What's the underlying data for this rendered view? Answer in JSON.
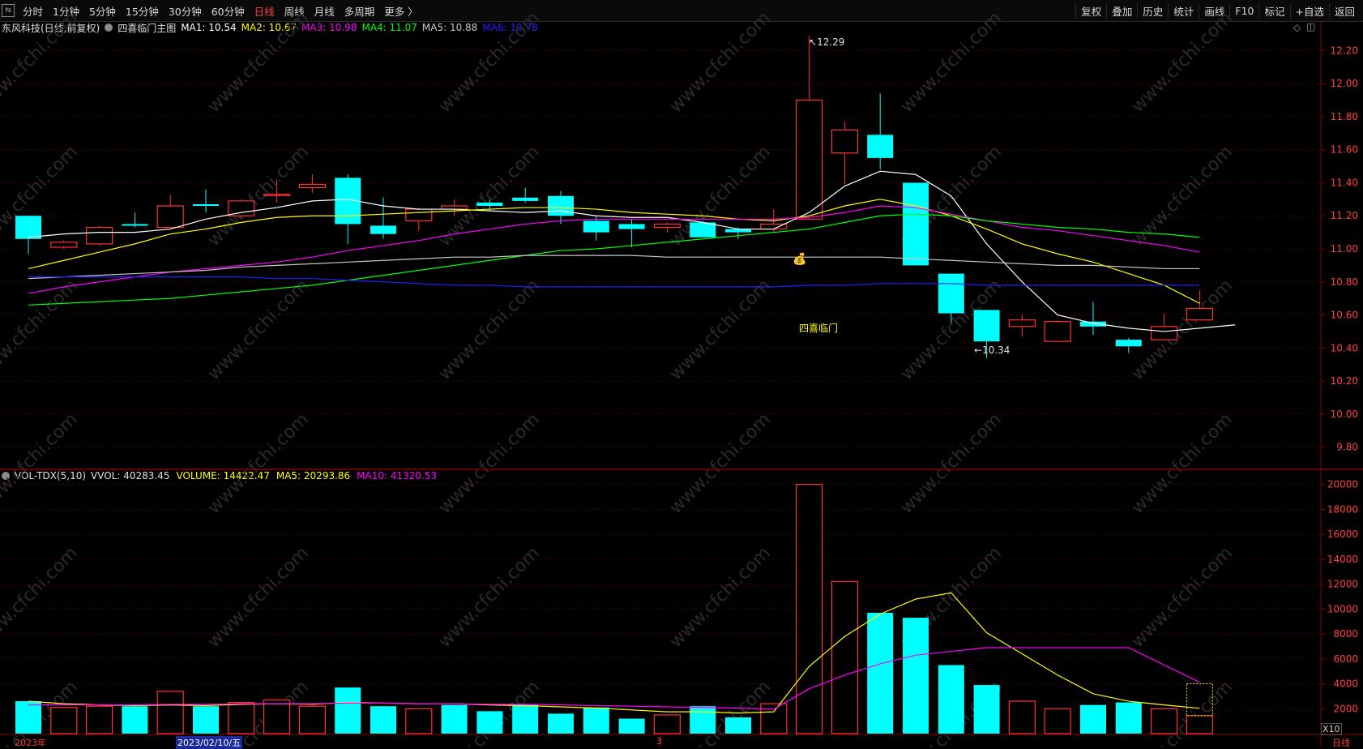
{
  "toolbar": {
    "periods": [
      {
        "label": "分时",
        "active": false
      },
      {
        "label": "1分钟",
        "active": false
      },
      {
        "label": "5分钟",
        "active": false
      },
      {
        "label": "15分钟",
        "active": false
      },
      {
        "label": "30分钟",
        "active": false
      },
      {
        "label": "60分钟",
        "active": false
      },
      {
        "label": "日线",
        "active": true
      },
      {
        "label": "周线",
        "active": false
      },
      {
        "label": "月线",
        "active": false
      },
      {
        "label": "多周期",
        "active": false
      },
      {
        "label": "更多 〉",
        "active": false
      }
    ],
    "right": [
      "复权",
      "叠加",
      "历史",
      "统计",
      "画线",
      "F10",
      "标记",
      "+自选",
      "返回"
    ]
  },
  "main_legend": {
    "stock": "东风科技(日线,前复权)",
    "indicator": "四喜临门主图",
    "items": [
      {
        "label": "MA1: 10.54",
        "color": "#ffffff"
      },
      {
        "label": "MA2: 10.67",
        "color": "#ffff00"
      },
      {
        "label": "MA3: 10.98",
        "color": "#ff00ff"
      },
      {
        "label": "MA4: 11.07",
        "color": "#00ff00"
      },
      {
        "label": "MA5: 10.88",
        "color": "#c8c8c8"
      },
      {
        "label": "MA6: 10.78",
        "color": "#2020ff"
      }
    ]
  },
  "vol_legend": {
    "name": "VOL-TDX(5,10)",
    "items": [
      {
        "label": "VVOL: 40283.45",
        "color": "#e0e0e0"
      },
      {
        "label": "VOLUME: 14422.47",
        "color": "#ffff00"
      },
      {
        "label": "MA5: 20293.86",
        "color": "#ffff00"
      },
      {
        "label": "MA10: 41320.53",
        "color": "#ff00ff"
      }
    ]
  },
  "annotations": {
    "high": "12.29",
    "low": "10.34",
    "signal": "四喜临门",
    "unit": "X10"
  },
  "watermark": "www.cfchi.com",
  "x_labels": [
    "2023年",
    "2023/02/10/五",
    "3"
  ],
  "period_tag": "日线",
  "colors": {
    "up": "#ff3232",
    "down": "#00ffff",
    "bg": "#000000",
    "grid": "#7a0000"
  },
  "chart_data": [
    {
      "type": "candlestick",
      "title": "东风科技(日线,前复权)",
      "ylim": [
        9.7,
        12.3
      ],
      "y_ticks": [
        9.8,
        10.0,
        10.2,
        10.4,
        10.6,
        10.8,
        11.0,
        11.2,
        11.4,
        11.6,
        11.8,
        12.0,
        12.2
      ],
      "candles": [
        {
          "o": 11.2,
          "h": 11.2,
          "l": 10.97,
          "c": 11.06
        },
        {
          "o": 11.01,
          "h": 11.05,
          "l": 11.0,
          "c": 11.04
        },
        {
          "o": 11.03,
          "h": 11.14,
          "l": 11.02,
          "c": 11.13
        },
        {
          "o": 11.15,
          "h": 11.22,
          "l": 11.13,
          "c": 11.14
        },
        {
          "o": 11.13,
          "h": 11.33,
          "l": 11.13,
          "c": 11.26
        },
        {
          "o": 11.27,
          "h": 11.36,
          "l": 11.22,
          "c": 11.26
        },
        {
          "o": 11.2,
          "h": 11.3,
          "l": 11.19,
          "c": 11.29
        },
        {
          "o": 11.33,
          "h": 11.42,
          "l": 11.28,
          "c": 11.33
        },
        {
          "o": 11.37,
          "h": 11.45,
          "l": 11.34,
          "c": 11.39
        },
        {
          "o": 11.43,
          "h": 11.45,
          "l": 11.03,
          "c": 11.15
        },
        {
          "o": 11.14,
          "h": 11.31,
          "l": 11.06,
          "c": 11.09
        },
        {
          "o": 11.17,
          "h": 11.25,
          "l": 11.11,
          "c": 11.24
        },
        {
          "o": 11.24,
          "h": 11.3,
          "l": 11.2,
          "c": 11.26
        },
        {
          "o": 11.28,
          "h": 11.3,
          "l": 11.23,
          "c": 11.26
        },
        {
          "o": 11.31,
          "h": 11.37,
          "l": 11.28,
          "c": 11.29
        },
        {
          "o": 11.32,
          "h": 11.35,
          "l": 11.15,
          "c": 11.2
        },
        {
          "o": 11.17,
          "h": 11.2,
          "l": 11.05,
          "c": 11.1
        },
        {
          "o": 11.15,
          "h": 11.18,
          "l": 11.01,
          "c": 11.12
        },
        {
          "o": 11.13,
          "h": 11.16,
          "l": 11.1,
          "c": 11.15
        },
        {
          "o": 11.16,
          "h": 11.17,
          "l": 11.07,
          "c": 11.07
        },
        {
          "o": 11.12,
          "h": 11.13,
          "l": 11.06,
          "c": 11.1
        },
        {
          "o": 11.12,
          "h": 11.24,
          "l": 11.1,
          "c": 11.15
        },
        {
          "o": 11.18,
          "h": 12.29,
          "l": 11.18,
          "c": 11.9
        },
        {
          "o": 11.58,
          "h": 11.77,
          "l": 11.39,
          "c": 11.72
        },
        {
          "o": 11.69,
          "h": 11.94,
          "l": 11.48,
          "c": 11.55
        },
        {
          "o": 11.4,
          "h": 11.4,
          "l": 10.9,
          "c": 10.9
        },
        {
          "o": 10.85,
          "h": 10.85,
          "l": 10.55,
          "c": 10.61
        },
        {
          "o": 10.63,
          "h": 10.63,
          "l": 10.34,
          "c": 10.44
        },
        {
          "o": 10.53,
          "h": 10.6,
          "l": 10.47,
          "c": 10.57
        },
        {
          "o": 10.44,
          "h": 10.57,
          "l": 10.44,
          "c": 10.56
        },
        {
          "o": 10.56,
          "h": 10.68,
          "l": 10.48,
          "c": 10.53
        },
        {
          "o": 10.45,
          "h": 10.46,
          "l": 10.37,
          "c": 10.41
        },
        {
          "o": 10.45,
          "h": 10.61,
          "l": 10.45,
          "c": 10.53
        },
        {
          "o": 10.57,
          "h": 10.75,
          "l": 10.57,
          "c": 10.64
        }
      ],
      "series": [
        {
          "name": "MA1",
          "color": "#ffffff",
          "values": [
            11.07,
            11.09,
            11.1,
            11.1,
            11.12,
            11.18,
            11.22,
            11.25,
            11.29,
            11.3,
            11.26,
            11.24,
            11.24,
            11.23,
            11.22,
            11.23,
            11.2,
            11.19,
            11.19,
            11.16,
            11.12,
            11.12,
            11.22,
            11.38,
            11.47,
            11.45,
            11.32,
            11.03,
            10.8,
            10.6,
            10.55,
            10.52,
            10.5,
            10.52,
            10.54
          ]
        },
        {
          "name": "MA2",
          "color": "#ffff00",
          "values": [
            10.88,
            10.93,
            10.98,
            11.03,
            11.09,
            11.12,
            11.16,
            11.19,
            11.2,
            11.2,
            11.21,
            11.22,
            11.23,
            11.24,
            11.25,
            11.25,
            11.24,
            11.22,
            11.21,
            11.2,
            11.18,
            11.17,
            11.2,
            11.26,
            11.3,
            11.26,
            11.2,
            11.12,
            11.03,
            10.97,
            10.92,
            10.85,
            10.78,
            10.67
          ]
        },
        {
          "name": "MA3",
          "color": "#ff00ff",
          "values": [
            10.73,
            10.77,
            10.8,
            10.83,
            10.86,
            10.88,
            10.9,
            10.92,
            10.95,
            10.99,
            11.02,
            11.05,
            11.09,
            11.12,
            11.15,
            11.17,
            11.18,
            11.18,
            11.18,
            11.18,
            11.18,
            11.18,
            11.19,
            11.22,
            11.26,
            11.25,
            11.21,
            11.17,
            11.13,
            11.11,
            11.08,
            11.05,
            11.02,
            10.98
          ]
        },
        {
          "name": "MA4",
          "color": "#00ff00",
          "values": [
            10.66,
            10.67,
            10.68,
            10.69,
            10.7,
            10.72,
            10.74,
            10.76,
            10.78,
            10.81,
            10.84,
            10.87,
            10.9,
            10.93,
            10.96,
            10.99,
            11.0,
            11.02,
            11.04,
            11.06,
            11.08,
            11.1,
            11.12,
            11.16,
            11.2,
            11.21,
            11.2,
            11.17,
            11.15,
            11.13,
            11.12,
            11.1,
            11.09,
            11.07
          ]
        },
        {
          "name": "MA5",
          "color": "#c8c8c8",
          "values": [
            10.82,
            10.83,
            10.84,
            10.85,
            10.86,
            10.87,
            10.89,
            10.9,
            10.91,
            10.92,
            10.93,
            10.94,
            10.95,
            10.95,
            10.96,
            10.96,
            10.96,
            10.96,
            10.95,
            10.95,
            10.95,
            10.95,
            10.95,
            10.95,
            10.95,
            10.94,
            10.93,
            10.92,
            10.91,
            10.9,
            10.9,
            10.89,
            10.88,
            10.88
          ]
        },
        {
          "name": "MA6",
          "color": "#2020ff",
          "values": [
            10.83,
            10.83,
            10.83,
            10.83,
            10.83,
            10.83,
            10.83,
            10.82,
            10.82,
            10.81,
            10.8,
            10.79,
            10.78,
            10.78,
            10.77,
            10.77,
            10.77,
            10.77,
            10.77,
            10.77,
            10.77,
            10.77,
            10.78,
            10.78,
            10.79,
            10.79,
            10.79,
            10.78,
            10.78,
            10.78,
            10.78,
            10.78,
            10.78,
            10.78
          ]
        }
      ]
    },
    {
      "type": "bar",
      "title": "VOL-TDX(5,10)",
      "ylim": [
        0,
        20500
      ],
      "y_ticks": [
        2000,
        4000,
        6000,
        8000,
        10000,
        12000,
        14000,
        16000,
        18000,
        20000
      ],
      "values": [
        2600,
        2100,
        2200,
        2200,
        3400,
        2200,
        2500,
        2700,
        2200,
        3700,
        2200,
        2000,
        2300,
        1800,
        2300,
        1600,
        2100,
        1200,
        1500,
        2200,
        1300,
        2400,
        20000,
        12200,
        9700,
        9300,
        5500,
        3900,
        2600,
        2000,
        2300,
        2500,
        2000,
        1440
      ],
      "up": [
        false,
        true,
        true,
        false,
        true,
        false,
        true,
        true,
        true,
        false,
        false,
        true,
        false,
        false,
        false,
        false,
        false,
        false,
        true,
        false,
        false,
        true,
        true,
        true,
        false,
        false,
        false,
        false,
        true,
        true,
        false,
        false,
        true,
        true
      ],
      "series": [
        {
          "name": "MA5",
          "color": "#ffff00",
          "values": [
            2600,
            2400,
            2300,
            2250,
            2300,
            2250,
            2350,
            2400,
            2350,
            2500,
            2450,
            2400,
            2400,
            2300,
            2250,
            2150,
            2050,
            1900,
            1750,
            1750,
            1650,
            1750,
            5400,
            7800,
            9600,
            10800,
            11300,
            8100,
            6400,
            4700,
            3200,
            2600,
            2300,
            2030
          ]
        },
        {
          "name": "MA10",
          "color": "#ff00ff",
          "values": [
            2300,
            2300,
            2300,
            2300,
            2350,
            2350,
            2400,
            2400,
            2400,
            2450,
            2450,
            2400,
            2400,
            2350,
            2350,
            2300,
            2250,
            2200,
            2150,
            2100,
            2050,
            1950,
            3600,
            4700,
            5600,
            6300,
            6600,
            6900,
            6900,
            6900,
            6900,
            6900,
            5500,
            4130
          ]
        }
      ]
    }
  ]
}
